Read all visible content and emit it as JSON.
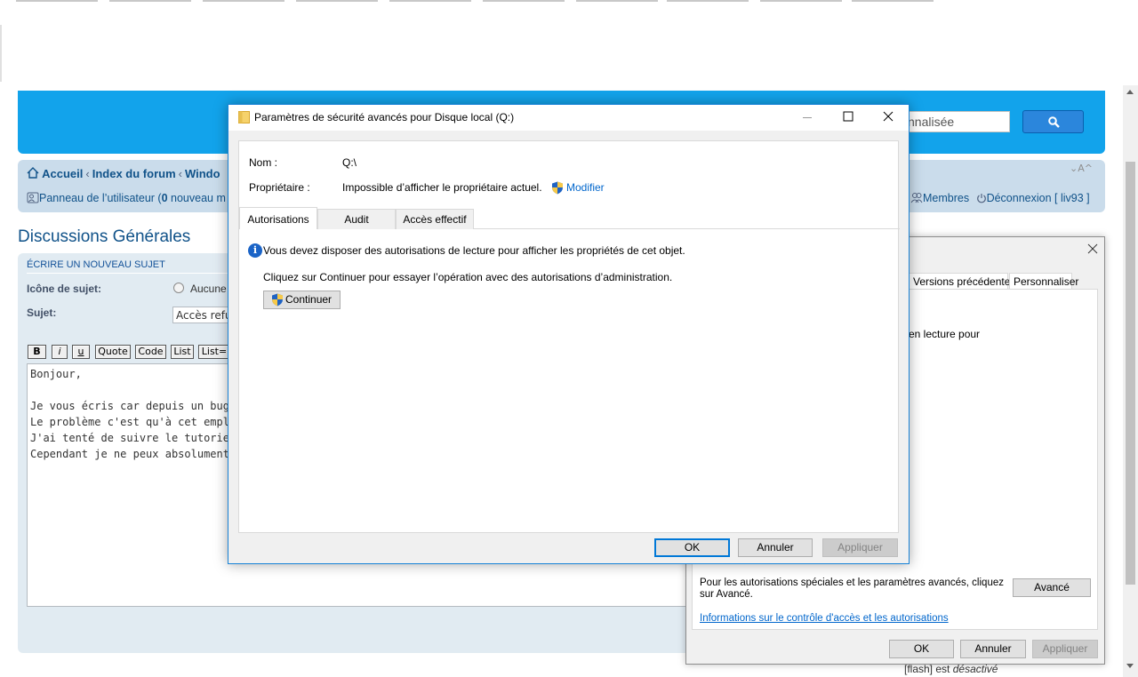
{
  "forum": {
    "search_placeholder": "nnalisée",
    "breadcrumbs": [
      "Accueil",
      "Index du forum",
      "Windo"
    ],
    "crumb_seps": [
      "‹",
      "‹"
    ],
    "user_panel": "Panneau de l’utilisateur (",
    "user_panel_count": "0",
    "user_panel_rest": " nouveau m",
    "members": "Membres",
    "logout": "Déconnexion [ liv93 ]",
    "font_size": "⌄A^",
    "page_title": "Discussions Générales",
    "post_section": "ÉCRIRE UN NOUVEAU SUJET",
    "icon_label": "Icône de sujet:",
    "icon_none": "Aucune",
    "subject_label": "Sujet:",
    "subject_value": "Accès refu",
    "bbcode_buttons": [
      "B",
      "i",
      "u",
      "Quote",
      "Code",
      "List",
      "List="
    ],
    "message": "Bonjour,\n\nJe vous écris car depuis un bug ou viru\nLe problème c'est qu'à cet emplaceme\nJ'ai tenté de suivre le tutoriel : http:/\nCependant je ne peux absolument pas",
    "flash_label": "[flash]",
    "flash_is": "est",
    "flash_state": "désactivé"
  },
  "properties_dialog": {
    "tabs": [
      "Versions précédentes",
      "Personnaliser"
    ],
    "fragment_text": "en lecture pour",
    "advanced_text": "Pour les autorisations spéciales et les paramètres avancés, cliquez sur Avancé.",
    "advanced_button": "Avancé",
    "help_link": "Informations sur le contrôle d'accès et les autorisations",
    "ok": "OK",
    "cancel": "Annuler",
    "apply": "Appliquer"
  },
  "security_dialog": {
    "title": "Paramètres de sécurité avancés pour Disque local (Q:)",
    "name_label": "Nom :",
    "name_value": "Q:\\",
    "owner_label": "Propriétaire :",
    "owner_value": "Impossible d’afficher le propriétaire actuel.",
    "change_link": "Modifier",
    "tabs": [
      "Autorisations",
      "Audit",
      "Accès effectif"
    ],
    "active_tab": "Autorisations",
    "info_message": "Vous devez disposer des autorisations de lecture pour afficher les propriétés de cet objet.",
    "continue_message": "Cliquez sur Continuer pour essayer l’opération avec des autorisations d’administration.",
    "continue_button": "Continuer",
    "ok": "OK",
    "cancel": "Annuler",
    "apply": "Appliquer"
  },
  "colors": {
    "forum_header": "#12a3eb",
    "navbar": "#cadceb",
    "link": "#105289",
    "dialog_border": "#1883d7",
    "default_button_border": "#0078d7"
  }
}
